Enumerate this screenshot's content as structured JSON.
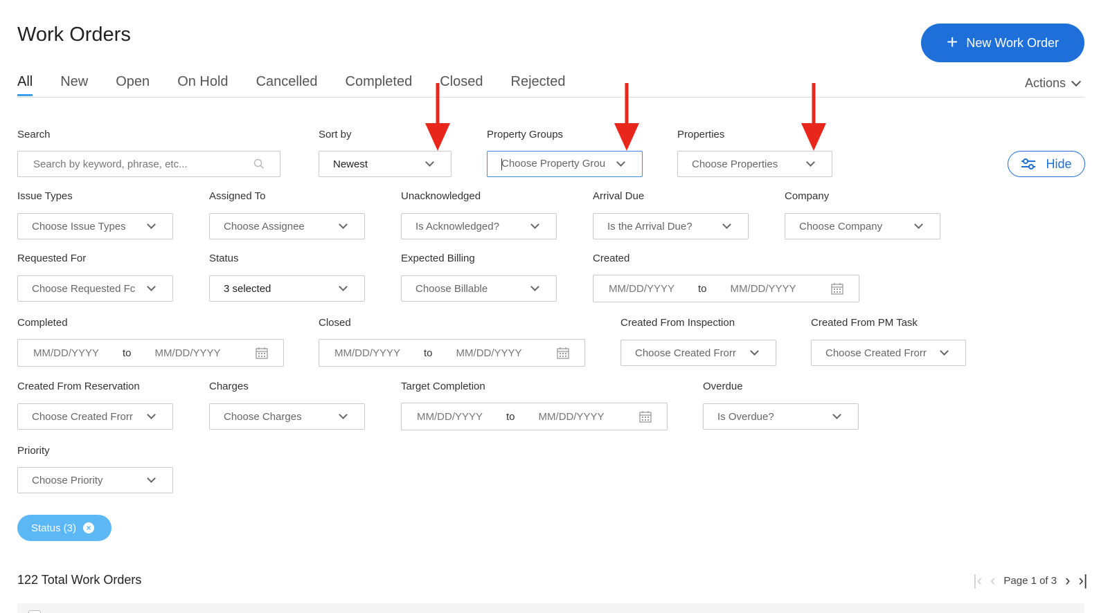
{
  "page": {
    "title": "Work Orders",
    "new_button": "New Work Order",
    "actions": "Actions"
  },
  "tabs": [
    {
      "label": "All",
      "active": true
    },
    {
      "label": "New"
    },
    {
      "label": "Open"
    },
    {
      "label": "On Hold"
    },
    {
      "label": "Cancelled"
    },
    {
      "label": "Completed"
    },
    {
      "label": "Closed"
    },
    {
      "label": "Rejected"
    }
  ],
  "filters": {
    "search": {
      "label": "Search",
      "placeholder": "Search by keyword, phrase, etc..."
    },
    "sort_by": {
      "label": "Sort by",
      "value": "Newest"
    },
    "property_groups": {
      "label": "Property Groups",
      "placeholder": "Choose Property Grou"
    },
    "properties": {
      "label": "Properties",
      "placeholder": "Choose Properties"
    },
    "hide_button": "Hide",
    "issue_types": {
      "label": "Issue Types",
      "placeholder": "Choose Issue Types"
    },
    "assigned_to": {
      "label": "Assigned To",
      "placeholder": "Choose Assignee"
    },
    "unacknowledged": {
      "label": "Unacknowledged",
      "placeholder": "Is Acknowledged?"
    },
    "arrival_due": {
      "label": "Arrival Due",
      "placeholder": "Is the Arrival Due?"
    },
    "company": {
      "label": "Company",
      "placeholder": "Choose Company"
    },
    "requested_for": {
      "label": "Requested For",
      "placeholder": "Choose Requested Fc"
    },
    "status": {
      "label": "Status",
      "value": "3 selected"
    },
    "expected_billing": {
      "label": "Expected Billing",
      "placeholder": "Choose Billable"
    },
    "created": {
      "label": "Created",
      "from": "MM/DD/YYYY",
      "to_word": "to",
      "to": "MM/DD/YYYY"
    },
    "completed": {
      "label": "Completed",
      "from": "MM/DD/YYYY",
      "to_word": "to",
      "to": "MM/DD/YYYY"
    },
    "closed": {
      "label": "Closed",
      "from": "MM/DD/YYYY",
      "to_word": "to",
      "to": "MM/DD/YYYY"
    },
    "created_from_inspection": {
      "label": "Created From Inspection",
      "placeholder": "Choose Created Frorr"
    },
    "created_from_pm_task": {
      "label": "Created From PM Task",
      "placeholder": "Choose Created Frorr"
    },
    "created_from_reservation": {
      "label": "Created From Reservation",
      "placeholder": "Choose Created Frorr"
    },
    "charges": {
      "label": "Charges",
      "placeholder": "Choose Charges"
    },
    "target_completion": {
      "label": "Target Completion",
      "from": "MM/DD/YYYY",
      "to_word": "to",
      "to": "MM/DD/YYYY"
    },
    "overdue": {
      "label": "Overdue",
      "placeholder": "Is Overdue?"
    },
    "priority": {
      "label": "Priority",
      "placeholder": "Choose Priority"
    }
  },
  "chip": {
    "label": "Status (3)"
  },
  "footer": {
    "total": "122 Total Work Orders",
    "pagination": "Page 1 of 3"
  },
  "colors": {
    "primary": "#1e6fd9",
    "chip": "#5bb8f5",
    "annotation_arrow": "#e8261c"
  }
}
